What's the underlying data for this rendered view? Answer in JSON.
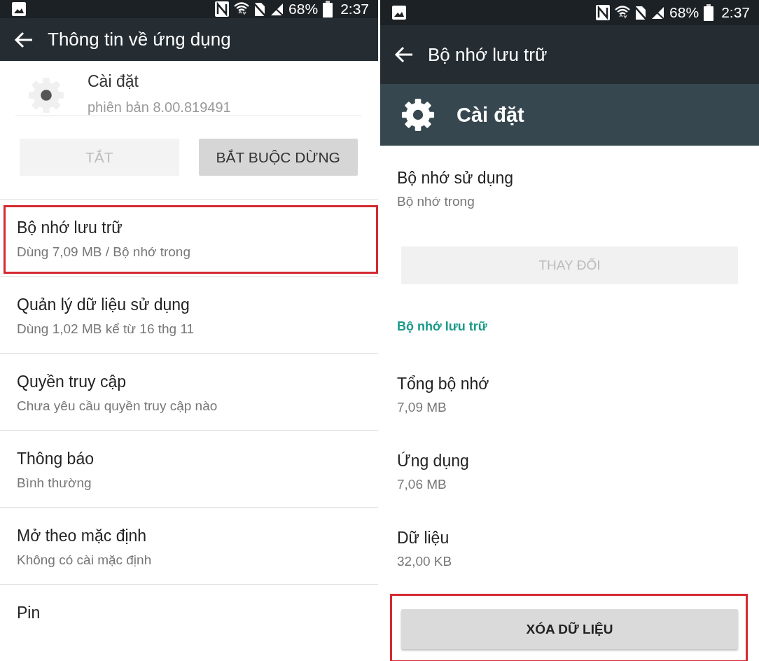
{
  "screens": [
    {
      "kind": "app_info",
      "status_bar": {
        "battery": "68%",
        "time": "2:37"
      },
      "app_bar": {
        "title": "Thông tin về ứng dụng"
      },
      "app": {
        "name": "Cài đặt",
        "version": "phiên bản 8.00.819491"
      },
      "buttons": [
        {
          "label": "TẮT",
          "disabled": true
        },
        {
          "label": "BẮT BUỘC DỪNG",
          "disabled": false
        }
      ],
      "items": [
        {
          "title": "Bộ nhớ lưu trữ",
          "subtitle": "Dùng 7,09 MB / Bộ nhớ trong",
          "highlighted": true
        },
        {
          "title": "Quản lý dữ liệu sử dụng",
          "subtitle": "Dùng 1,02 MB kể từ 16 thg 11",
          "highlighted": false
        },
        {
          "title": "Quyền truy cập",
          "subtitle": "Chưa yêu cầu quyền truy cập nào",
          "highlighted": false
        },
        {
          "title": "Thông báo",
          "subtitle": "Bình thường",
          "highlighted": false
        },
        {
          "title": "Mở theo mặc định",
          "subtitle": "Không có cài mặc định",
          "highlighted": false
        },
        {
          "title": "Pin",
          "highlighted": false
        }
      ]
    },
    {
      "kind": "storage",
      "status_bar": {
        "battery": "68%",
        "time": "2:37"
      },
      "app_bar": {
        "title": "Bộ nhớ lưu trữ"
      },
      "app": {
        "name": "Cài đặt"
      },
      "rows": [
        {
          "kind": "pref",
          "title": "Bộ nhớ sử dụng",
          "subtitle": "Bộ nhớ trong"
        },
        {
          "kind": "button",
          "label": "THAY ĐỔI",
          "disabled": true,
          "highlighted": false
        },
        {
          "kind": "section",
          "label": "Bộ nhớ lưu trữ"
        },
        {
          "kind": "pref",
          "title": "Tổng bộ nhớ",
          "subtitle": "7,09 MB"
        },
        {
          "kind": "pref",
          "title": "Ứng dụng",
          "subtitle": "7,06 MB"
        },
        {
          "kind": "pref",
          "title": "Dữ liệu",
          "subtitle": "32,00 KB"
        },
        {
          "kind": "button",
          "label": "XÓA DỮ LIỆU",
          "disabled": false,
          "highlighted": true
        }
      ]
    }
  ]
}
